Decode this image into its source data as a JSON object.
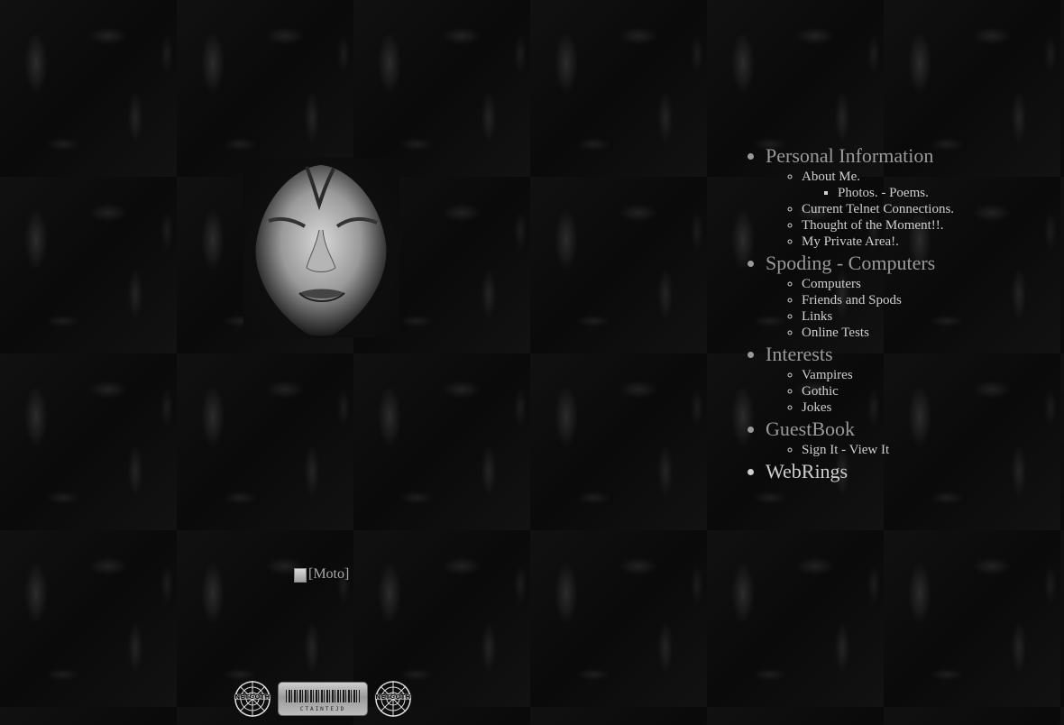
{
  "broken_image": {
    "alt": "[Moto]"
  },
  "badges": {
    "left": "NETGOTH",
    "barcode": "CTAINTEJD",
    "right": "NETGOTH"
  },
  "nav": {
    "sections": [
      {
        "title": "Personal Information",
        "items": [
          "About Me.",
          "Current Telnet Connections.",
          "Thought of the Moment!!.",
          "My Private Area!."
        ],
        "subitems": "Photos. - Poems."
      },
      {
        "title": "Spoding - Computers",
        "items": [
          "Computers",
          "Friends and Spods",
          "Links",
          "Online Tests"
        ]
      },
      {
        "title": "Interests",
        "items": [
          "Vampires",
          "Gothic",
          "Jokes"
        ]
      },
      {
        "title": "GuestBook",
        "items": [
          "Sign It - View It"
        ]
      },
      {
        "title": "WebRings",
        "items": []
      }
    ]
  },
  "colors": {
    "background": "#0c0c0c",
    "text": "#cfcfcf",
    "section_heading": "#9a9a9a",
    "bullet": "#8c8c8c"
  }
}
